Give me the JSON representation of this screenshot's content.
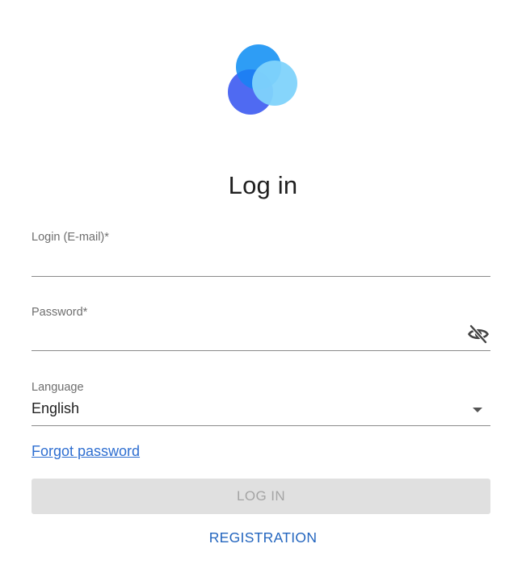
{
  "page": {
    "title": "Log in"
  },
  "logo": {
    "icon": "three-circles-logo",
    "colors": [
      "#2e9df5",
      "#4f6af2",
      "#7fd3fb"
    ]
  },
  "form": {
    "login": {
      "label": "Login (E-mail)*",
      "value": ""
    },
    "password": {
      "label": "Password*",
      "value": "",
      "toggle_icon": "eye-off-icon"
    },
    "language": {
      "label": "Language",
      "value": "English",
      "toggle_icon": "dropdown-arrow-icon"
    }
  },
  "links": {
    "forgot_password": "Forgot password"
  },
  "buttons": {
    "login": "LOG IN",
    "registration": "REGISTRATION"
  },
  "colors": {
    "link": "#2f6fd1",
    "registration": "#2466bf",
    "disabled_button_bg": "#e0e0e0",
    "disabled_button_text": "#a4a4a4"
  }
}
